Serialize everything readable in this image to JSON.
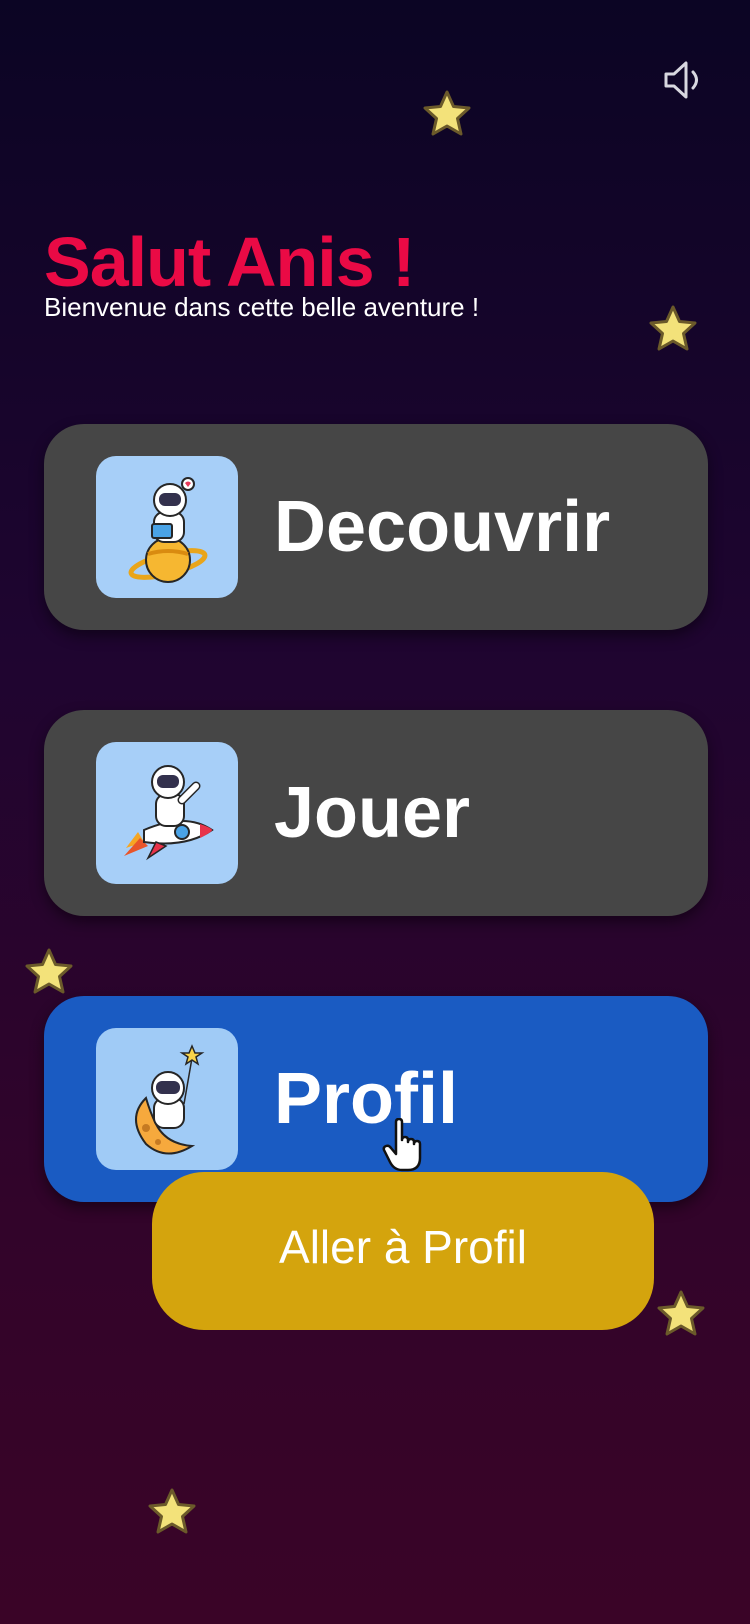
{
  "header": {
    "sound_icon": "speaker-icon",
    "title": "Salut Anis !",
    "subtitle": "Bienvenue dans cette belle aventure !"
  },
  "menu": [
    {
      "label": "Decouvrir",
      "icon": "astronaut-on-planet-reading-icon"
    },
    {
      "label": "Jouer",
      "icon": "astronaut-on-rocket-icon"
    },
    {
      "label": "Profil",
      "icon": "astronaut-on-moon-with-star-icon",
      "active": true
    }
  ],
  "tooltip": {
    "label": "Aller à Profil"
  },
  "colors": {
    "title": "#ea0a45",
    "card": "#464646",
    "card_active": "#1a5bc2",
    "thumb": "#a7cff8",
    "tooltip": "#d4a40d",
    "star": "#f3e27a"
  }
}
